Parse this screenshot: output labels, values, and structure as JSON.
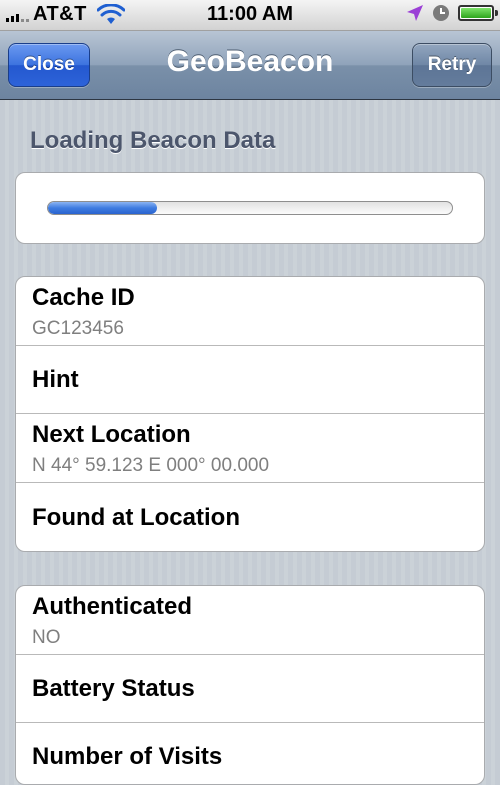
{
  "status_bar": {
    "carrier": "AT&T",
    "time": "11:00 AM",
    "signal_bars_active": 3,
    "signal_bars_total": 5,
    "icons": [
      "signal-icon",
      "wifi-icon",
      "location-arrow-icon",
      "clock-icon",
      "battery-icon"
    ]
  },
  "nav": {
    "title": "GeoBeacon",
    "left_button": "Close",
    "right_button": "Retry"
  },
  "section": {
    "title": "Loading Beacon Data"
  },
  "progress": {
    "value": 0.27
  },
  "group1": {
    "cells": [
      {
        "title": "Cache ID",
        "subtitle": "GC123456"
      },
      {
        "title": "Hint"
      },
      {
        "title": "Next Location",
        "subtitle": "N 44° 59.123 E 000° 00.000"
      },
      {
        "title": "Found at Location"
      }
    ]
  },
  "group2": {
    "cells": [
      {
        "title": "Authenticated",
        "subtitle": "NO"
      },
      {
        "title": "Battery Status"
      },
      {
        "title": "Number of Visits"
      }
    ]
  },
  "colors": {
    "close_button": "#3c73df",
    "retry_button": "#6f87a6",
    "progress_fill": "#3f7ce0",
    "section_title": "#4c566c",
    "subtitle": "#7f7f7f",
    "location_icon": "#9b3fd6"
  }
}
